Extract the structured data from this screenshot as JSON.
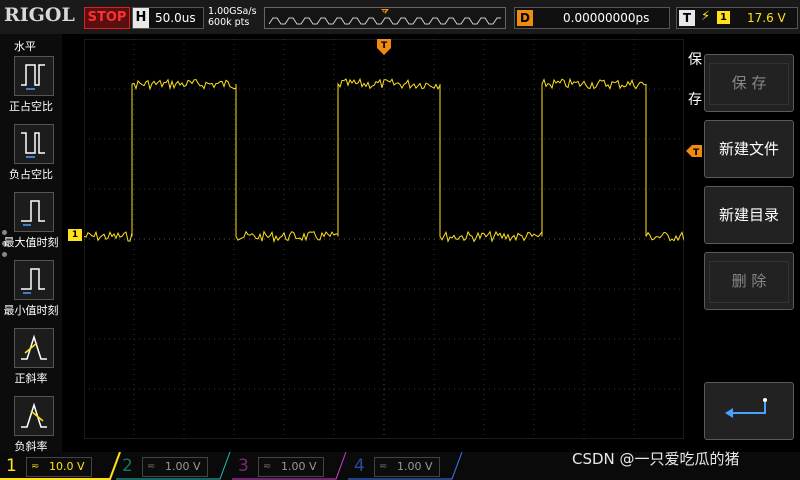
{
  "topbar": {
    "brand": "RIGOL",
    "run_state": "STOP",
    "timebase_key": "H",
    "timebase_value": "50.0us",
    "sample_rate": "1.00GSa/s",
    "memory_depth": "600k pts",
    "trigger_pos_label": "T",
    "delay_key": "D",
    "delay_value": "0.00000000ps",
    "trigger_key": "T",
    "trigger_edge": "⚡",
    "trigger_channel": "1",
    "trigger_level": "17.6 V"
  },
  "left_menu": {
    "title": "水平",
    "items": [
      {
        "label": "正占空比",
        "icon": "positive-duty-icon"
      },
      {
        "label": "负占空比",
        "icon": "negative-duty-icon"
      },
      {
        "label": "最大值时刻",
        "icon": "max-time-icon"
      },
      {
        "label": "最小值时刻",
        "icon": "min-time-icon"
      },
      {
        "label": "正斜率",
        "icon": "positive-slope-icon"
      },
      {
        "label": "负斜率",
        "icon": "negative-slope-icon"
      }
    ]
  },
  "channel_marker": "1",
  "right_menu": {
    "title_line1": "保",
    "title_line2": "存",
    "items": [
      {
        "label": "保 存",
        "enabled": false
      },
      {
        "label": "新建文件",
        "enabled": true
      },
      {
        "label": "新建目录",
        "enabled": true
      },
      {
        "label": "删 除",
        "enabled": false
      },
      {
        "label": "",
        "icon": "return-enter-icon",
        "enabled": true
      }
    ]
  },
  "channels": [
    {
      "num": "1",
      "coupling": "≂",
      "scale": "10.0 V",
      "color": "#ffe21a",
      "active": true
    },
    {
      "num": "2",
      "coupling": "≂",
      "scale": "1.00 V",
      "color": "#20c0c0",
      "active": false
    },
    {
      "num": "3",
      "coupling": "≂",
      "scale": "1.00 V",
      "color": "#d040d0",
      "active": false
    },
    {
      "num": "4",
      "coupling": "≂",
      "scale": "1.00 V",
      "color": "#3a7aff",
      "active": false
    }
  ],
  "waveform": {
    "type": "square",
    "color": "#ffe21a",
    "high_level_div": 3.1,
    "low_level_div": 0.05,
    "period_div": 4.1,
    "first_rise_div": 1.0,
    "duty": 0.5
  },
  "watermark": "CSDN @一只爱吃瓜的猪"
}
